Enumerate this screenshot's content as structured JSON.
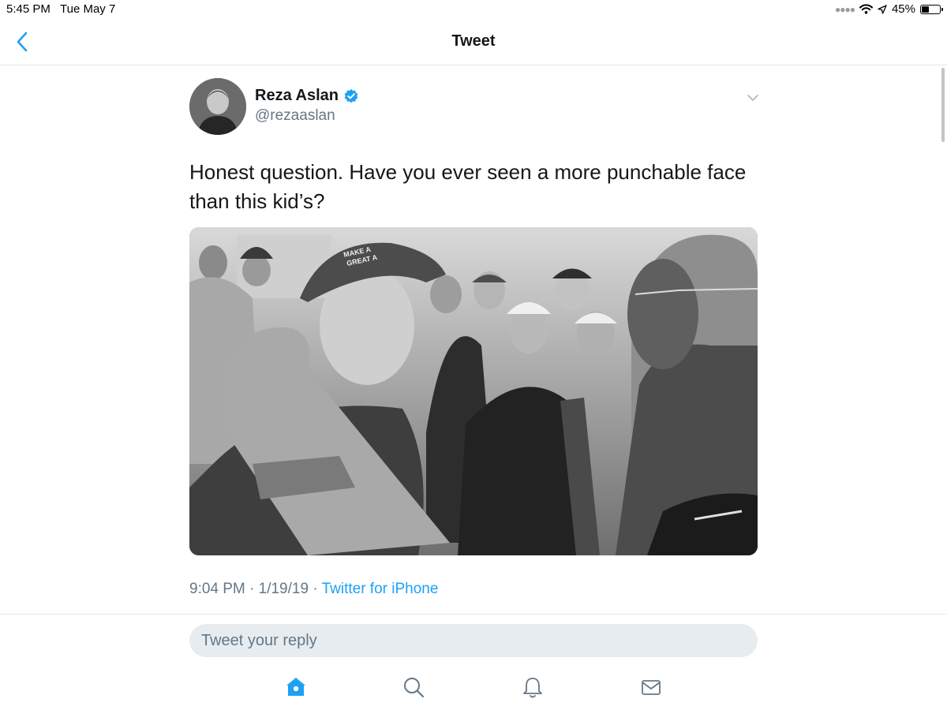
{
  "status_bar": {
    "time": "5:45 PM",
    "date": "Tue May 7",
    "battery_percent": "45%",
    "battery_level": 0.45
  },
  "nav": {
    "title": "Tweet"
  },
  "tweet": {
    "author": {
      "display_name": "Reza Aslan",
      "handle": "@rezaaslan",
      "verified": true
    },
    "text": "Honest question. Have you ever seen a more punchable face than this kid’s?",
    "timestamp": "9:04 PM · 1/19/19 · ",
    "source": "Twitter for iPhone",
    "media_caption_text": [
      "MAKE A",
      "GREAT A"
    ]
  },
  "reply": {
    "placeholder": "Tweet your reply"
  },
  "tabs": [
    {
      "name": "home-icon",
      "active": true
    },
    {
      "name": "search-icon",
      "active": false
    },
    {
      "name": "bell-icon",
      "active": false
    },
    {
      "name": "mail-icon",
      "active": false
    }
  ],
  "colors": {
    "accent": "#1da1f2",
    "secondary_text": "#657786",
    "divider": "#e1e8ed",
    "reply_bg": "#e6ecf0",
    "icon_gray": "#657786"
  }
}
